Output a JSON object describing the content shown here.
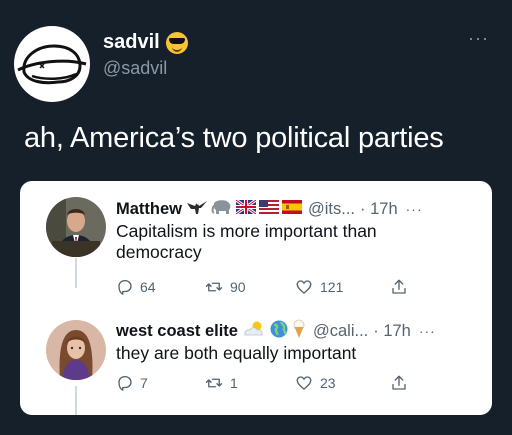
{
  "author": {
    "name": "sadvil",
    "handle": "@sadvil",
    "name_emoji_icon": "sunglasses-face-icon"
  },
  "tweet_text": "ah, America’s two political parties",
  "more_label": "···",
  "quoted": [
    {
      "name": "Matthew",
      "name_icons": [
        "eagle-icon",
        "elephant-icon",
        "uk-flag-icon",
        "us-flag-icon",
        "spain-flag-icon"
      ],
      "handle": "@its...",
      "time": "· 17h",
      "more": "···",
      "text": "Capitalism is more important than democracy",
      "replies": "64",
      "retweets": "90",
      "likes": "121"
    },
    {
      "name": "west coast elite",
      "name_icons": [
        "sun-cloud-icon",
        "globe-icon",
        "ice-cream-icon"
      ],
      "handle": "@cali...",
      "time": "· 17h",
      "more": "···",
      "text": "they are both equally important",
      "replies": "7",
      "retweets": "1",
      "likes": "23"
    }
  ],
  "colors": {
    "background": "#15202b",
    "card": "#ffffff",
    "muted": "#8b98a5",
    "gray_text": "#536471"
  }
}
